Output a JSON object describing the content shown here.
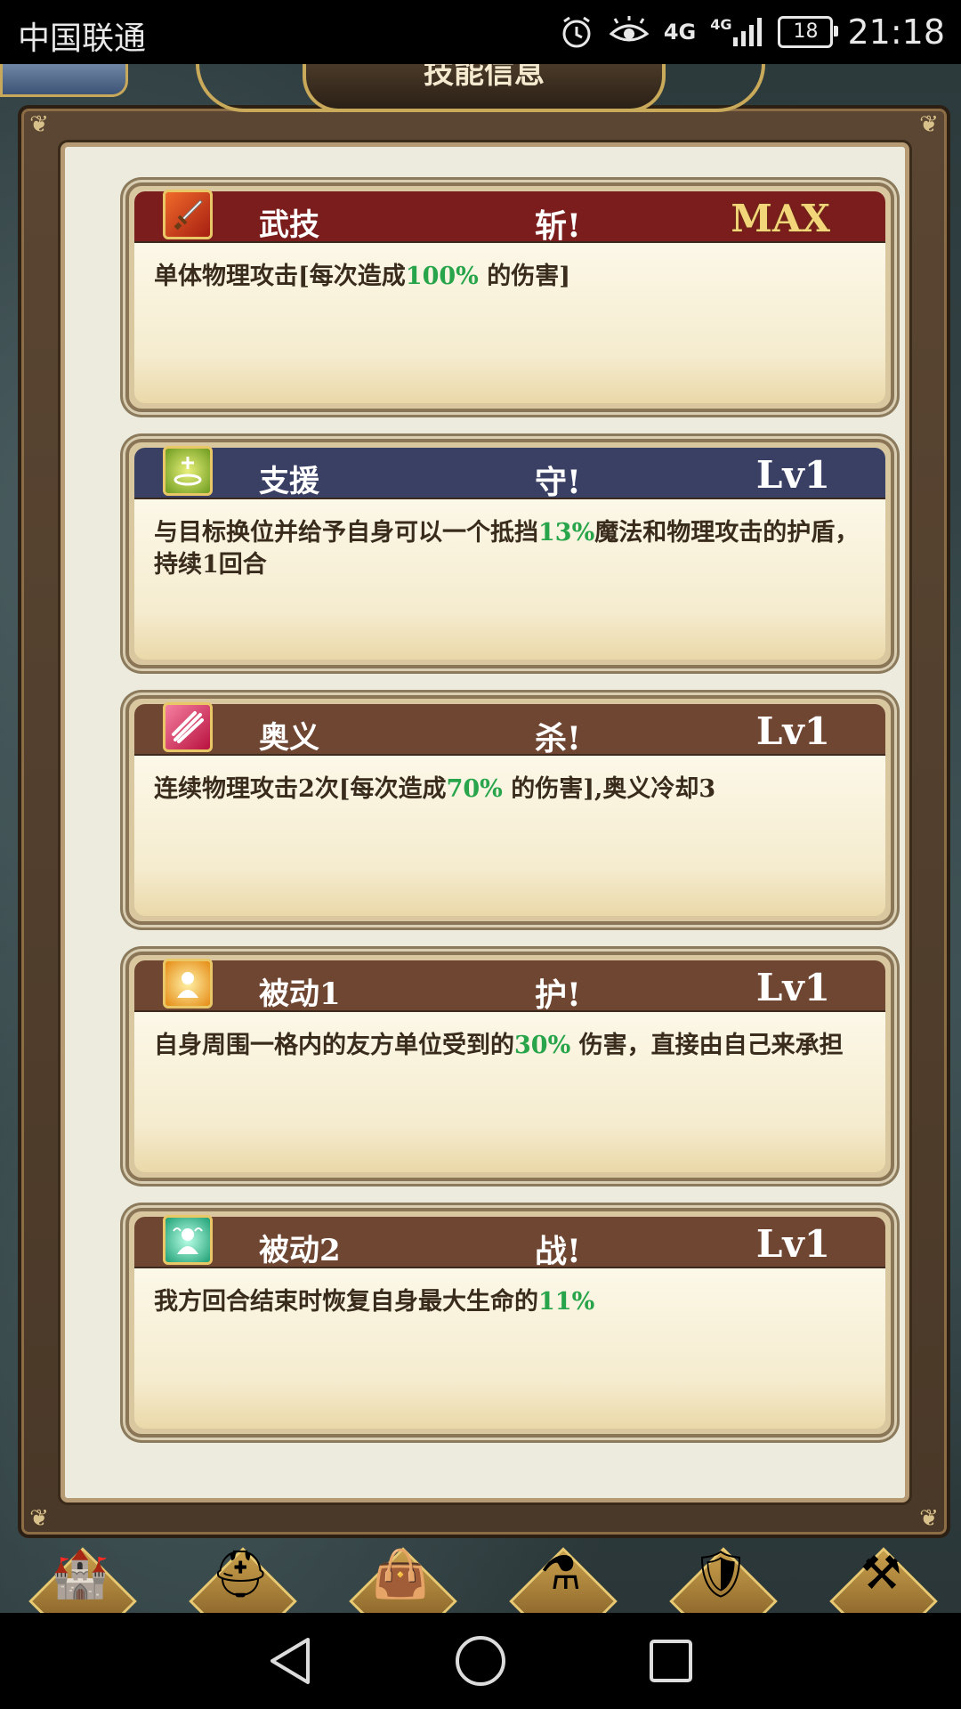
{
  "status_bar": {
    "carrier": "中国联通",
    "network_1": "4G",
    "network_2": "4G",
    "battery": "18",
    "time": "21:18"
  },
  "header": {
    "title": "技能信息"
  },
  "skills": [
    {
      "type": "武技",
      "name": "斩!",
      "level": "MAX",
      "icon": "sword-icon",
      "header_color": "#7b1d1d",
      "desc_parts": [
        "单体物理攻击[每次造成",
        "100%",
        " 的伤害]"
      ]
    },
    {
      "type": "支援",
      "name": "守!",
      "level": "Lv1",
      "icon": "support-aura-icon",
      "header_color": "#3a3f64",
      "desc_parts": [
        "与目标换位并给予自身可以一个抵挡",
        "13%",
        "魔法和物理攻击的护盾，持续1回合"
      ]
    },
    {
      "type": "奥义",
      "name": "杀!",
      "level": "Lv1",
      "icon": "slash-burst-icon",
      "header_color": "#6e4632",
      "desc_parts": [
        "连续物理攻击2次[每次造成",
        "70%",
        " 的伤害],奥义冷却3"
      ]
    },
    {
      "type": "被动1",
      "name": "护!",
      "level": "Lv1",
      "icon": "guard-person-icon",
      "header_color": "#6e4632",
      "desc_parts": [
        "自身周围一格内的友方单位受到的",
        "30%",
        " 伤害，直接由自己来承担"
      ]
    },
    {
      "type": "被动2",
      "name": "战!",
      "level": "Lv1",
      "icon": "heal-person-icon",
      "header_color": "#6e4632",
      "desc_parts": [
        "我方回合结束时恢复自身最大生命的",
        "11%",
        ""
      ]
    }
  ],
  "bottom_menu": [
    {
      "icon": "castle-icon",
      "glyph": "🏰"
    },
    {
      "icon": "helmet-icon",
      "glyph": "⛑"
    },
    {
      "icon": "bag-icon",
      "glyph": "👜"
    },
    {
      "icon": "potion-icon",
      "glyph": "⚗"
    },
    {
      "icon": "shield-crest-icon",
      "glyph": "🛡"
    },
    {
      "icon": "forge-icon",
      "glyph": "⚒"
    }
  ],
  "colors": {
    "highlight_green": "#28a44a",
    "max_gold": "#f3d67a"
  }
}
